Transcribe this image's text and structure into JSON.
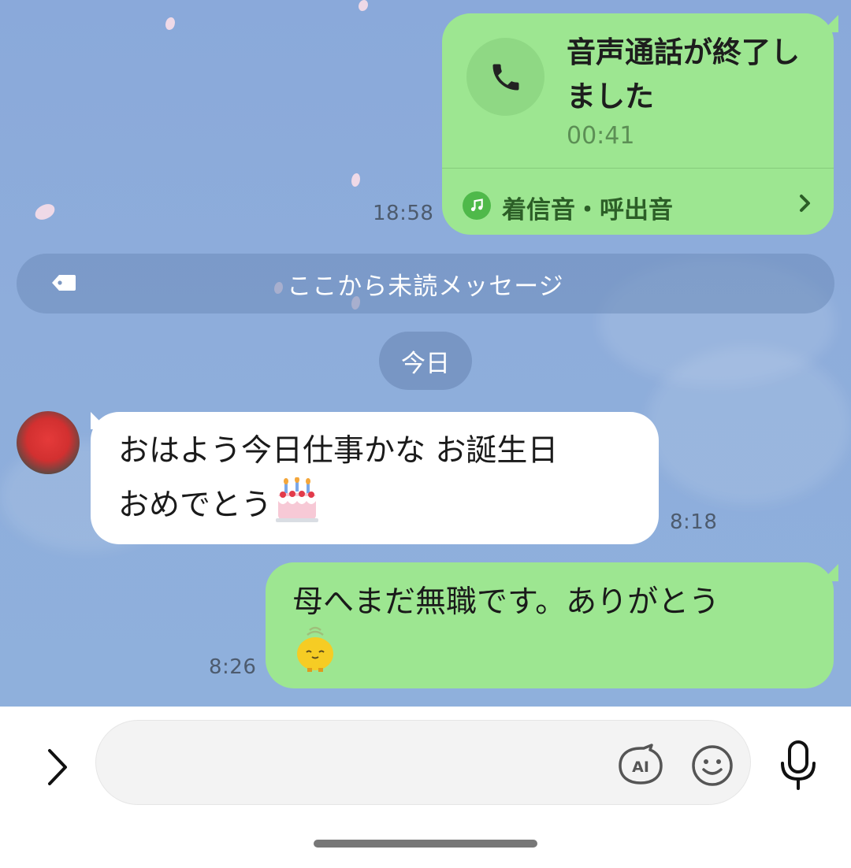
{
  "chat": {
    "call_message": {
      "title": "音声通話が終了しました",
      "duration": "00:41",
      "ringtone_label": "着信音・呼出音",
      "time": "18:58"
    },
    "unread_label": "ここから未読メッセージ",
    "date_label": "今日",
    "incoming_message": {
      "line1": "おはよう今日仕事かな お誕生日",
      "line2": "おめでとう",
      "emoji": "🎂",
      "time": "8:18"
    },
    "outgoing_message": {
      "line1": "母へまだ無職です。ありがとう",
      "time": "8:26"
    }
  },
  "input_bar": {
    "placeholder": "",
    "ai_label": "AI"
  },
  "colors": {
    "chat_background": "#8aa9da",
    "sent_bubble": "#9de691",
    "received_bubble": "#ffffff",
    "ringtone_accent": "#4fb94a"
  },
  "icons": [
    "phone-icon",
    "music-note-icon",
    "chevron-right-icon",
    "tag-icon",
    "chevron-right-expand-icon",
    "ai-icon",
    "emoji-icon",
    "microphone-icon",
    "birthday-cake-emoji",
    "chick-emoji"
  ]
}
